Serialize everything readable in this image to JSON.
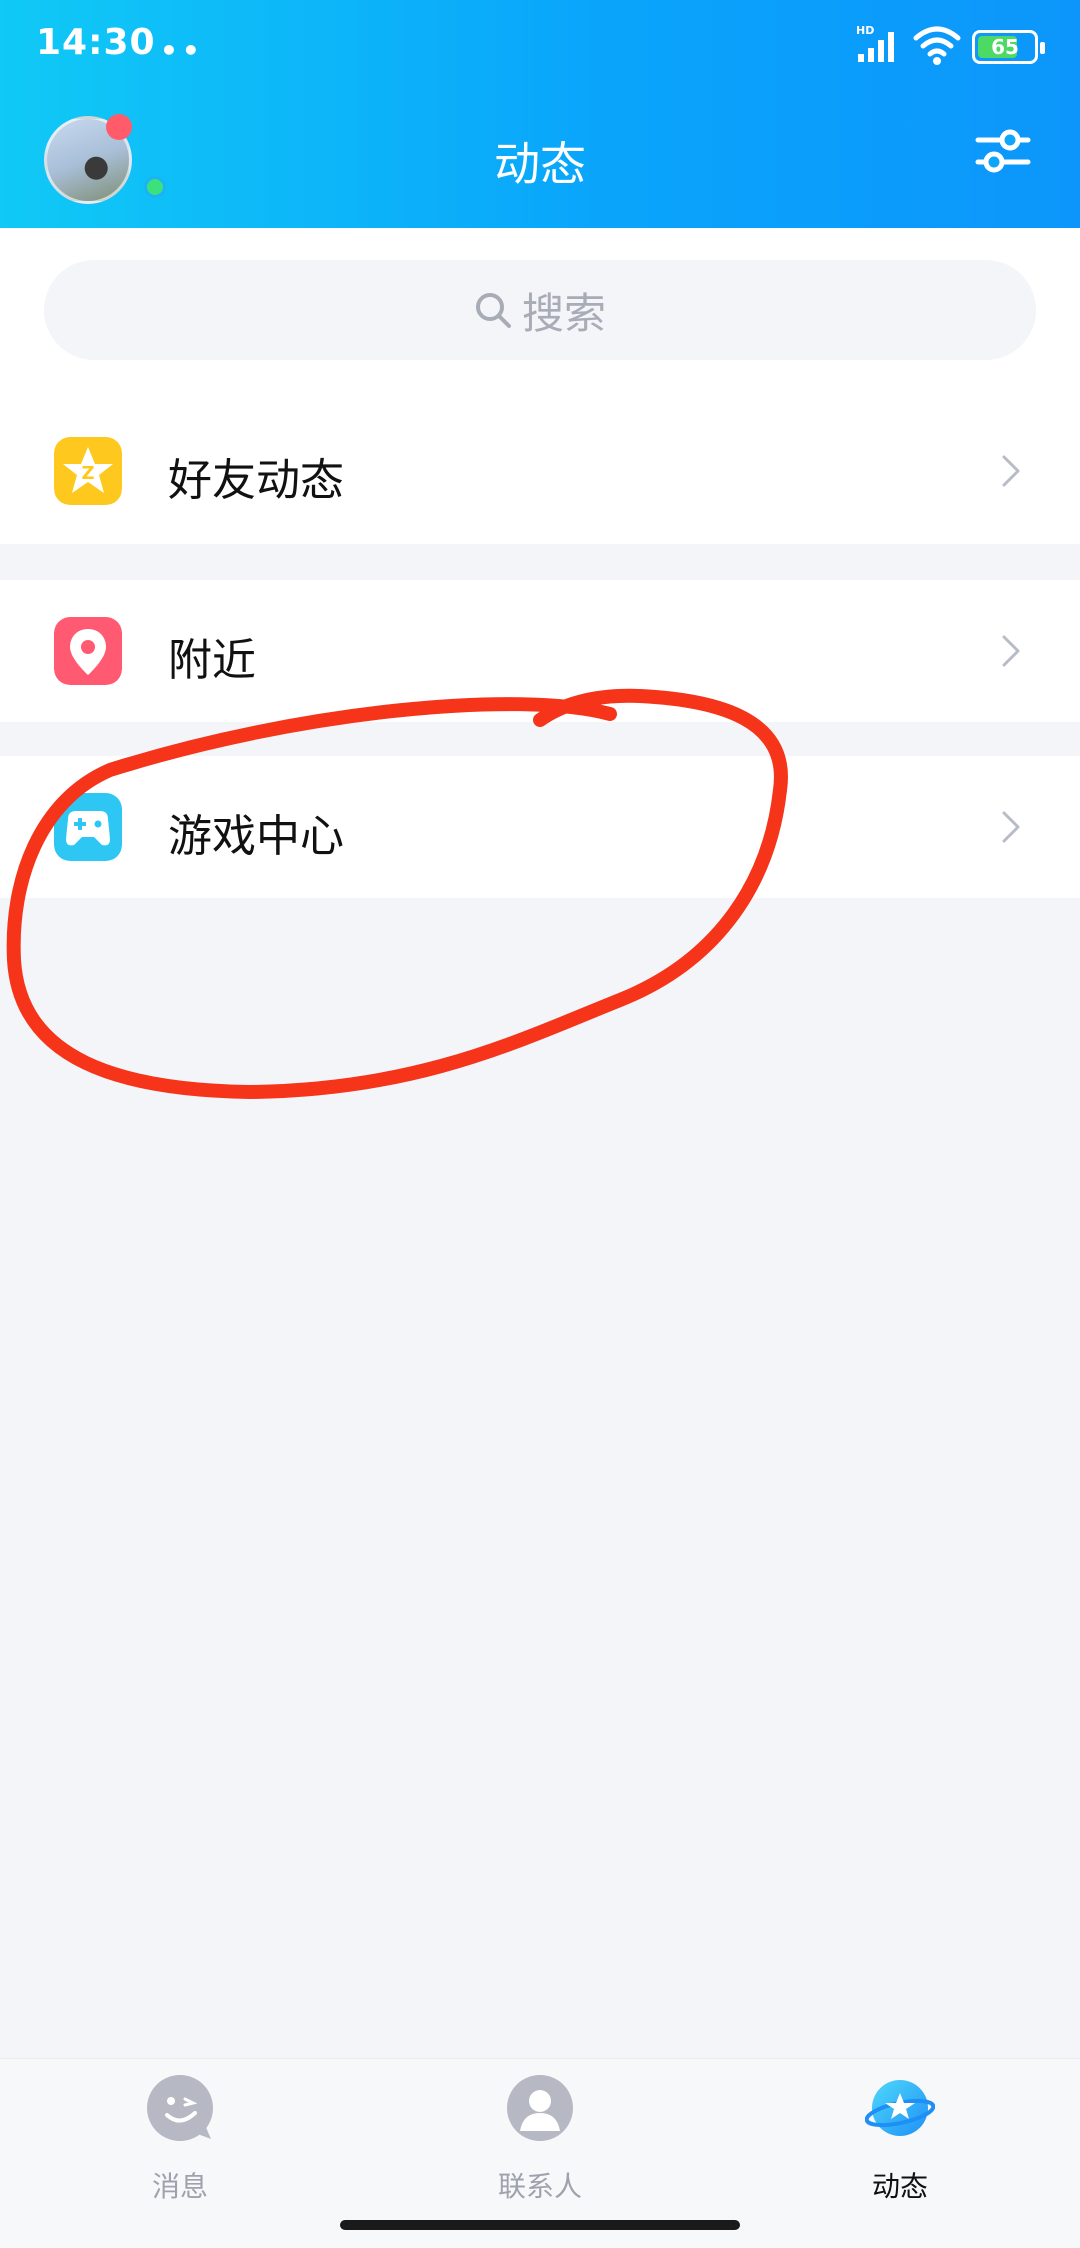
{
  "status_bar": {
    "time": "14:30",
    "dots": "••",
    "network": "HD",
    "battery": "65"
  },
  "header": {
    "title": "动态"
  },
  "search": {
    "placeholder": "搜索"
  },
  "menu": {
    "items": [
      {
        "label": "好友动态",
        "icon": "qzone-star-icon",
        "color": "#ffc81e"
      },
      {
        "label": "附近",
        "icon": "location-pin-icon",
        "color": "#ff5a72"
      },
      {
        "label": "游戏中心",
        "icon": "gamepad-icon",
        "color": "#2ec6f3"
      }
    ]
  },
  "tabbar": {
    "tabs": [
      {
        "label": "消息",
        "icon": "message-face-icon"
      },
      {
        "label": "联系人",
        "icon": "contact-person-icon"
      },
      {
        "label": "动态",
        "icon": "planet-star-icon",
        "active": true
      }
    ]
  },
  "colors": {
    "header_start": "#10c9f6",
    "header_end": "#0c96fb",
    "annotation": "#f5341a"
  }
}
